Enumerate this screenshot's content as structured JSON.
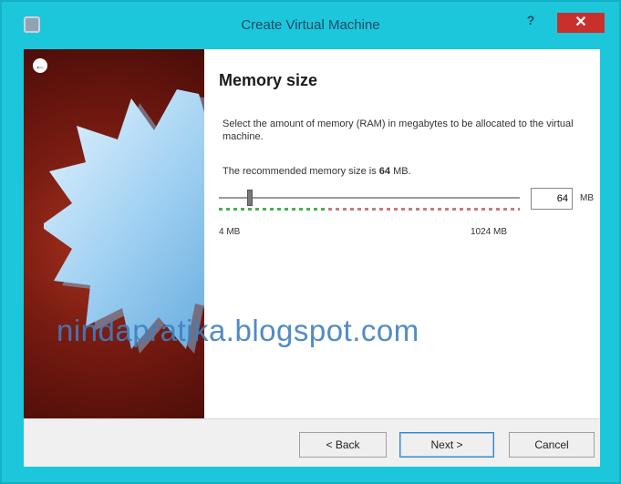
{
  "window": {
    "title": "Create Virtual Machine",
    "help_label": "?",
    "close_label": "✕"
  },
  "page": {
    "heading": "Memory size",
    "description": "Select the amount of memory (RAM) in megabytes to be allocated to the virtual machine.",
    "recommended_prefix": "The recommended memory size is ",
    "recommended_value": "64",
    "recommended_suffix": " MB."
  },
  "memory": {
    "value": "64",
    "unit": "MB",
    "min_label": "4 MB",
    "max_label": "1024 MB",
    "min": 4,
    "max": 1024,
    "current": 64
  },
  "buttons": {
    "back": "< Back",
    "next": "Next >",
    "cancel": "Cancel"
  },
  "watermark": "nindapratika.blogspot.com",
  "colors": {
    "frame": "#1cc7dc",
    "close": "#c9302c",
    "accent": "#3a86c8",
    "wizard_bg": "#7a1c12"
  }
}
